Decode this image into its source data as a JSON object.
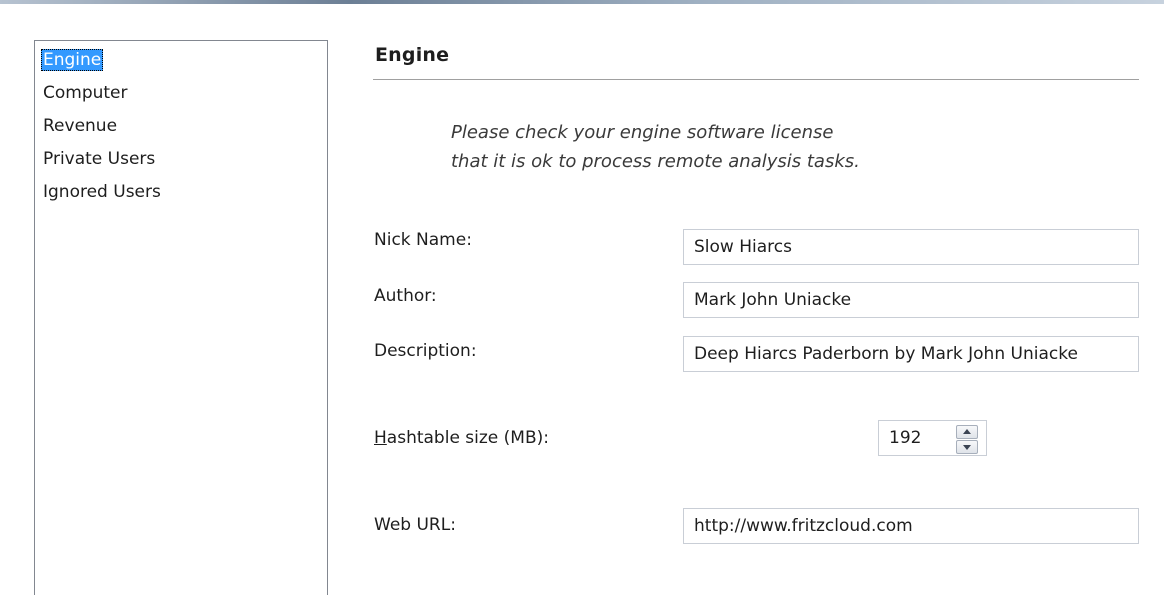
{
  "nav": {
    "items": [
      {
        "label": "Engine",
        "selected": true
      },
      {
        "label": "Computer",
        "selected": false
      },
      {
        "label": "Revenue",
        "selected": false
      },
      {
        "label": "Private Users",
        "selected": false
      },
      {
        "label": "Ignored Users",
        "selected": false
      }
    ]
  },
  "panel": {
    "title": "Engine",
    "notice_line1": "Please check your engine software license",
    "notice_line2": "that it is ok to process remote analysis tasks."
  },
  "form": {
    "nick_name": {
      "label": "Nick Name:",
      "value": "Slow Hiarcs"
    },
    "author": {
      "label": "Author:",
      "value": "Mark John Uniacke"
    },
    "description": {
      "label": "Description:",
      "value": "Deep Hiarcs Paderborn by Mark John Uniacke"
    },
    "hashtable": {
      "label_mnemonic": "H",
      "label_rest": "ashtable size (MB):",
      "value": "192"
    },
    "web_url": {
      "label": "Web URL:",
      "value": "http://www.fritzcloud.com"
    }
  },
  "colors": {
    "selection": "#3399ff",
    "border": "#828790",
    "rule": "#a0a0a0"
  }
}
